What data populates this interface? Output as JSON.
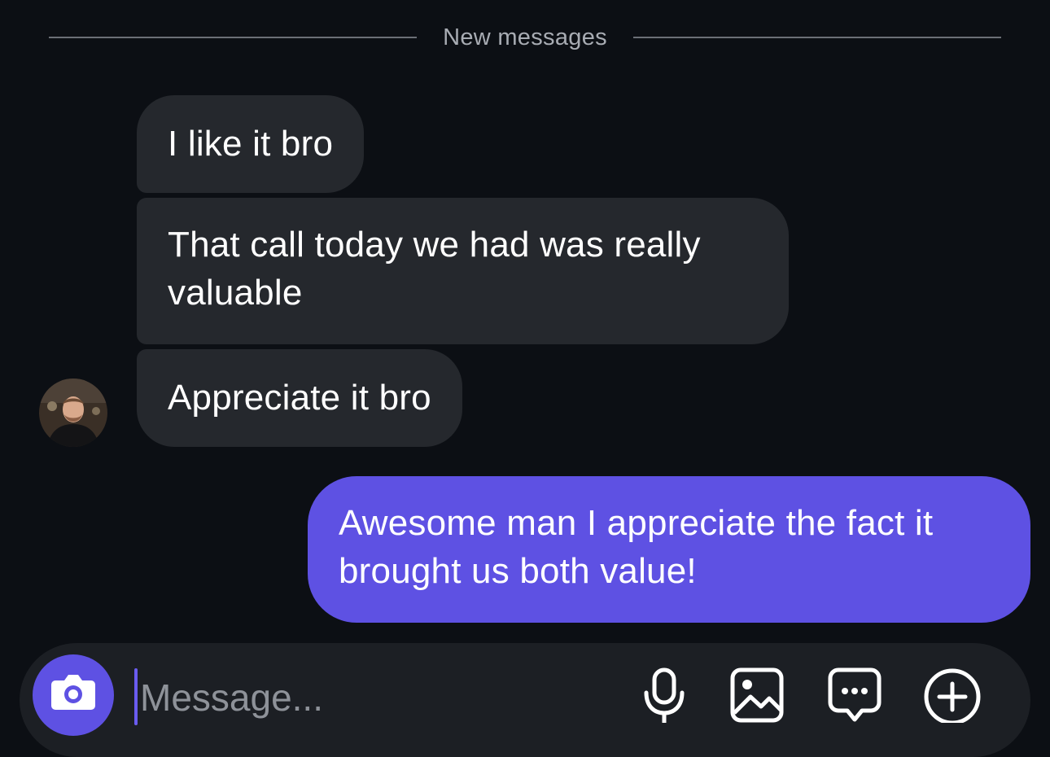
{
  "divider": {
    "label": "New messages"
  },
  "messages": [
    {
      "text": "I like it bro",
      "direction": "incoming"
    },
    {
      "text": "That call today we had was really valuable",
      "direction": "incoming"
    },
    {
      "text": "Appreciate it bro",
      "direction": "incoming"
    },
    {
      "text": "Awesome man I appreciate the fact it brought us both value!",
      "direction": "outgoing"
    }
  ],
  "composer": {
    "placeholder": "Message..."
  },
  "icons": {
    "camera": "camera-icon",
    "microphone": "microphone-icon",
    "gallery": "image-icon",
    "sticker": "chat-bubble-icon",
    "more": "plus-circle-icon"
  },
  "colors": {
    "background": "#0c0f14",
    "incoming_bubble": "#25282d",
    "outgoing_bubble": "#5e51e3",
    "accent": "#5e51e3"
  }
}
